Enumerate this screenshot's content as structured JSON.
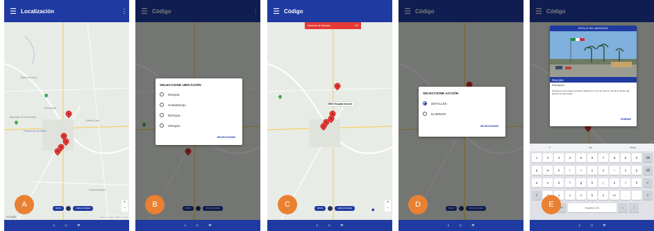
{
  "icons": {
    "menu": "hamburger-icon",
    "more": "overflow-menu-icon",
    "back": "back-icon",
    "home": "home-icon",
    "recents": "recents-icon",
    "map_pin": "map-pin-icon",
    "park": "park-marker-icon",
    "zoom_in": "plus-icon",
    "zoom_out": "minus-icon",
    "compass": "compass-icon"
  },
  "colors": {
    "appbar": "#1f3aa0",
    "badge": "#e98032",
    "pin": "#e53935",
    "toast": "#e53935"
  },
  "nav_glyphs": {
    "back": "‹",
    "home": "○",
    "recents": "≡"
  },
  "screens": {
    "a": {
      "title": "Localización",
      "badge": "A",
      "buttons": [
        "RPZO",
        "UBICACIONES"
      ],
      "google": "Google",
      "attribution": "Datos de mapas ©2021 Google",
      "map_labels": [
        "Bahía de Kino",
        "Hermosillo",
        "Municipio de Hermosillo",
        "Parque de los Niños",
        "Santa Clara",
        "Carrera Ranch"
      ]
    },
    "b": {
      "title": "Código",
      "badge": "B",
      "dialog": {
        "title": "SELECCIONE UBICACIÓN",
        "options": [
          "Navojoa",
          "Huatabampo",
          "Etchojoa",
          "Obregón"
        ],
        "action": "SELECCIONAR"
      }
    },
    "c": {
      "title": "Código",
      "badge": "C",
      "toast": {
        "text": "Ubicación de Marcador",
        "value": "+20"
      },
      "infowindow": "RIEG Hospital General"
    },
    "d": {
      "title": "Código",
      "badge": "D",
      "dialog": {
        "title": "SELECCIONE ACCIÓN",
        "options": [
          "DETALLES",
          "ELIMINAR"
        ],
        "selected": 0,
        "action": "SELECCIONAR"
      }
    },
    "e": {
      "title": "Código",
      "badge": "E",
      "detail": {
        "header": "DETALLE DEL MARCADOR",
        "name": "Navojoa",
        "subtitle": "Descripción",
        "description": "Navojoa es una ciudad mexicana ubicada en el sur de Sonora, siendo la quinta más grande de este estado",
        "action": "CERRAR"
      },
      "suggestions": [
        "Y",
        "Ya",
        "Hola"
      ],
      "keyboard": {
        "row1": [
          "1",
          "2",
          "3",
          "4",
          "5",
          "6",
          "7",
          "8",
          "9",
          "0",
          "⌫"
        ],
        "row2": [
          "q",
          "w",
          "e",
          "r",
          "t",
          "y",
          "u",
          "i",
          "o",
          "p",
          "⌫"
        ],
        "row3": [
          "a",
          "s",
          "d",
          "f",
          "g",
          "h",
          "j",
          "k",
          "l",
          "ñ",
          "↵"
        ],
        "row4": [
          "⇧",
          "z",
          "x",
          "c",
          "v",
          "b",
          "n",
          "m",
          ",",
          ".",
          "⇧"
        ],
        "row5": [
          "Ctrl",
          "!?",
          "Español (US)",
          "‹",
          "›"
        ]
      }
    }
  }
}
